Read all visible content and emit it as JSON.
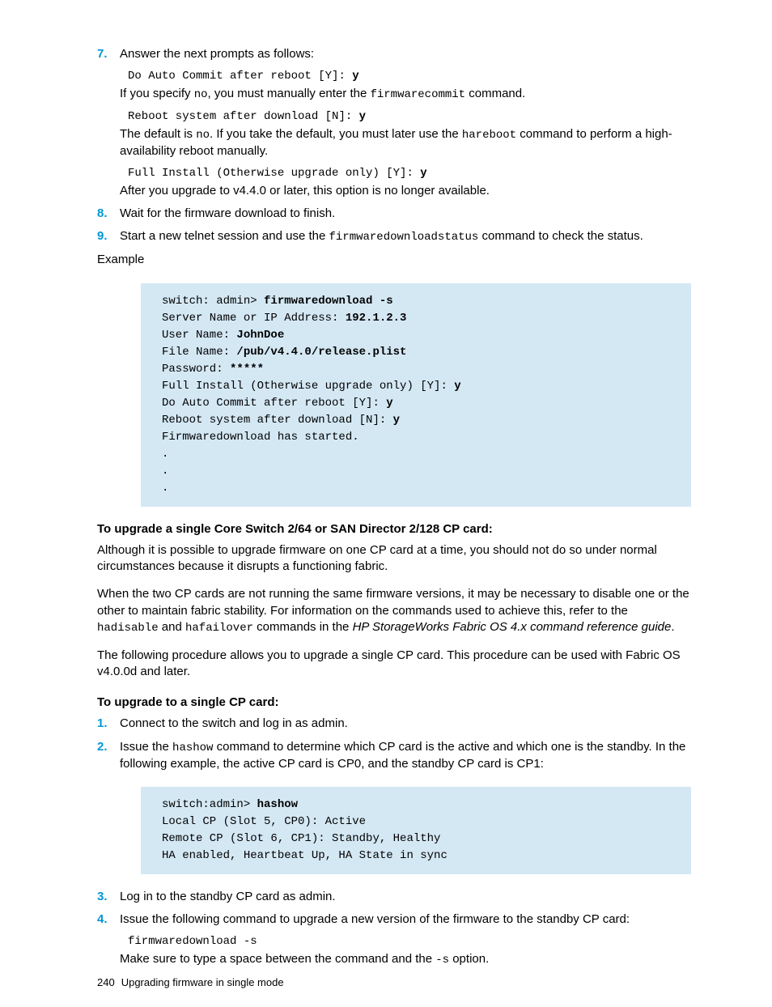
{
  "step7": {
    "num": "7.",
    "intro": "Answer the next prompts as follows:",
    "prompt1_pre": "Do Auto Commit after reboot [Y]: ",
    "prompt1_bold": "y",
    "para1_a": "If you specify ",
    "para1_code1": "no",
    "para1_b": ", you must manually enter the ",
    "para1_code2": "firmwarecommit",
    "para1_c": " command.",
    "prompt2_pre": "Reboot system after download [N]: ",
    "prompt2_bold": "y",
    "para2_a": "The default is ",
    "para2_code1": "no",
    "para2_b": ". If you take the default, you must later use the ",
    "para2_code2": "hareboot",
    "para2_c": " command to perform a high-availability reboot manually.",
    "prompt3_pre": "Full Install (Otherwise upgrade only) [Y]: ",
    "prompt3_bold": "y",
    "para3": "After you upgrade to v4.4.0 or later, this option is no longer available."
  },
  "step8": {
    "num": "8.",
    "text": "Wait for the firmware download to finish."
  },
  "step9": {
    "num": "9.",
    "a": "Start a new telnet session and use the ",
    "code": "firmwaredownloadstatus",
    "b": " command to check the status."
  },
  "example_label": "Example",
  "code1": {
    "l1a": "switch: admin> ",
    "l1b": "firmwaredownload -s",
    "l2a": "Server Name or IP Address: ",
    "l2b": "192.1.2.3",
    "l3a": "User Name: ",
    "l3b": "JohnDoe",
    "l4a": "File Name: ",
    "l4b": "/pub/v4.4.0/release.plist",
    "l5a": "Password: ",
    "l5b": "*****",
    "l6a": "Full Install (Otherwise upgrade only) [Y]: ",
    "l6b": "y",
    "l7a": "Do Auto Commit after reboot [Y]: ",
    "l7b": "y",
    "l8a": "Reboot system after download [N]: ",
    "l8b": "y",
    "l9": "Firmwaredownload has started.",
    "l10": ".",
    "l11": ".",
    "l12": "."
  },
  "h1": "To upgrade a single Core Switch 2/64 or SAN Director 2/128 CP card:",
  "p1": "Although it is possible to upgrade firmware on one CP card at a time, you should not do so under normal circumstances because it disrupts a functioning fabric.",
  "p2": {
    "a": "When the two CP cards are not running the same firmware versions, it may be necessary to disable one or the other to maintain fabric stability. For information on the commands used to achieve this, refer to the ",
    "code1": "hadisable",
    "b": " and ",
    "code2": "hafailover",
    "c": " commands in the ",
    "italic": "HP StorageWorks Fabric OS 4.x command reference guide",
    "d": "."
  },
  "p3": "The following procedure allows you to upgrade a single CP card. This procedure can be used with Fabric OS v4.0.0d and later.",
  "h2": "To upgrade to a single CP card:",
  "s1": {
    "num": "1.",
    "text": "Connect to the switch and log in as admin."
  },
  "s2": {
    "num": "2.",
    "a": "Issue the ",
    "code": "hashow",
    "b": " command to determine which CP card is the active and which one is the standby. In the following example, the active CP card is CP0, and the standby CP card is CP1:"
  },
  "code2": {
    "l1a": "switch:admin> ",
    "l1b": "hashow",
    "l2": "Local CP (Slot 5, CP0): Active",
    "l3": "Remote CP (Slot 6, CP1): Standby, Healthy",
    "l4": "HA enabled, Heartbeat Up, HA State in sync"
  },
  "s3": {
    "num": "3.",
    "text": "Log in to the standby CP card as admin."
  },
  "s4": {
    "num": "4.",
    "text": "Issue the following command to upgrade a new version of the firmware to the standby CP card:",
    "cmd": "firmwaredownload -s",
    "tail_a": "Make sure to type a space between the command and the ",
    "tail_code": "-s",
    "tail_b": " option."
  },
  "footer": {
    "page": "240",
    "title": "Upgrading firmware in single mode"
  }
}
